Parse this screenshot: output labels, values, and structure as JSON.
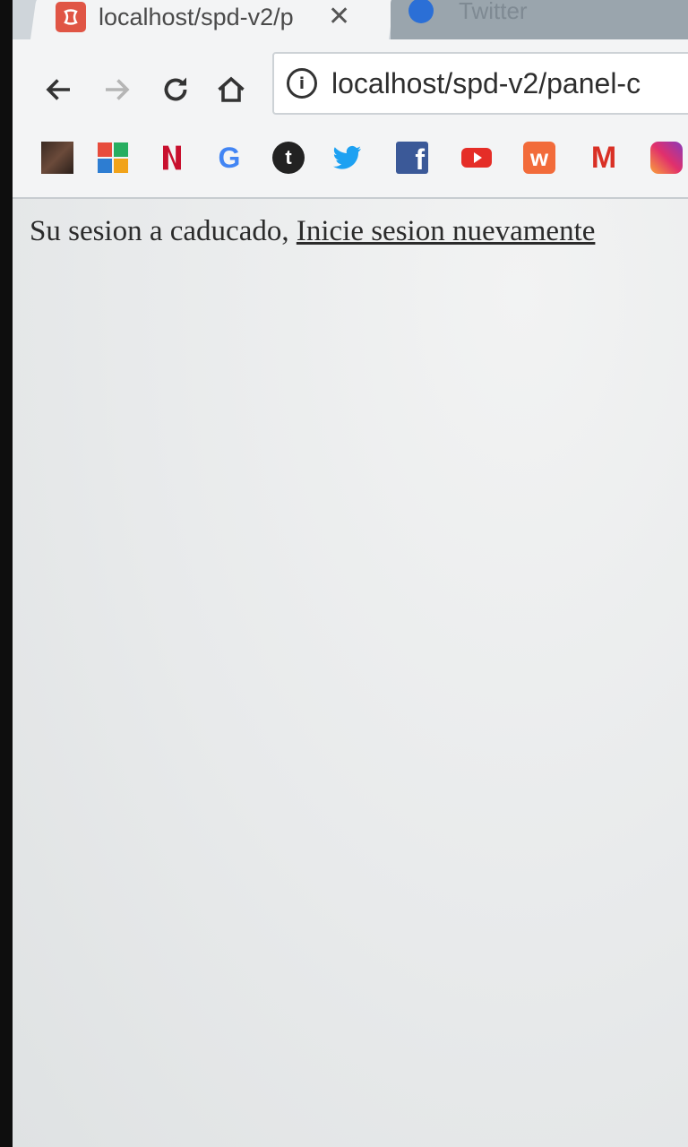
{
  "browser": {
    "tabs": [
      {
        "title": "localhost/spd-v2/p",
        "active": true,
        "close_glyph": "✕"
      },
      {
        "title": "Twitter",
        "active": false
      }
    ],
    "address": "localhost/spd-v2/panel-c",
    "bookmarks": [
      "photo-icon",
      "microsoft-icon",
      "netflix-icon",
      "google-icon",
      "tumblr-icon",
      "twitter-icon",
      "facebook-icon",
      "youtube-icon",
      "wattpad-icon",
      "gmail-icon",
      "instagram-icon"
    ],
    "google_letter": "G",
    "tumblr_letter": "t",
    "facebook_letter": "f",
    "wattpad_letter": "w",
    "gmail_letter": "M"
  },
  "page": {
    "message": "Su sesion a caducado, ",
    "link_text": "Inicie sesion nuevamente"
  },
  "colors": {
    "tab_strip": "#cfd5da",
    "toolbar": "#f3f4f5",
    "content": "#e9ebec"
  }
}
